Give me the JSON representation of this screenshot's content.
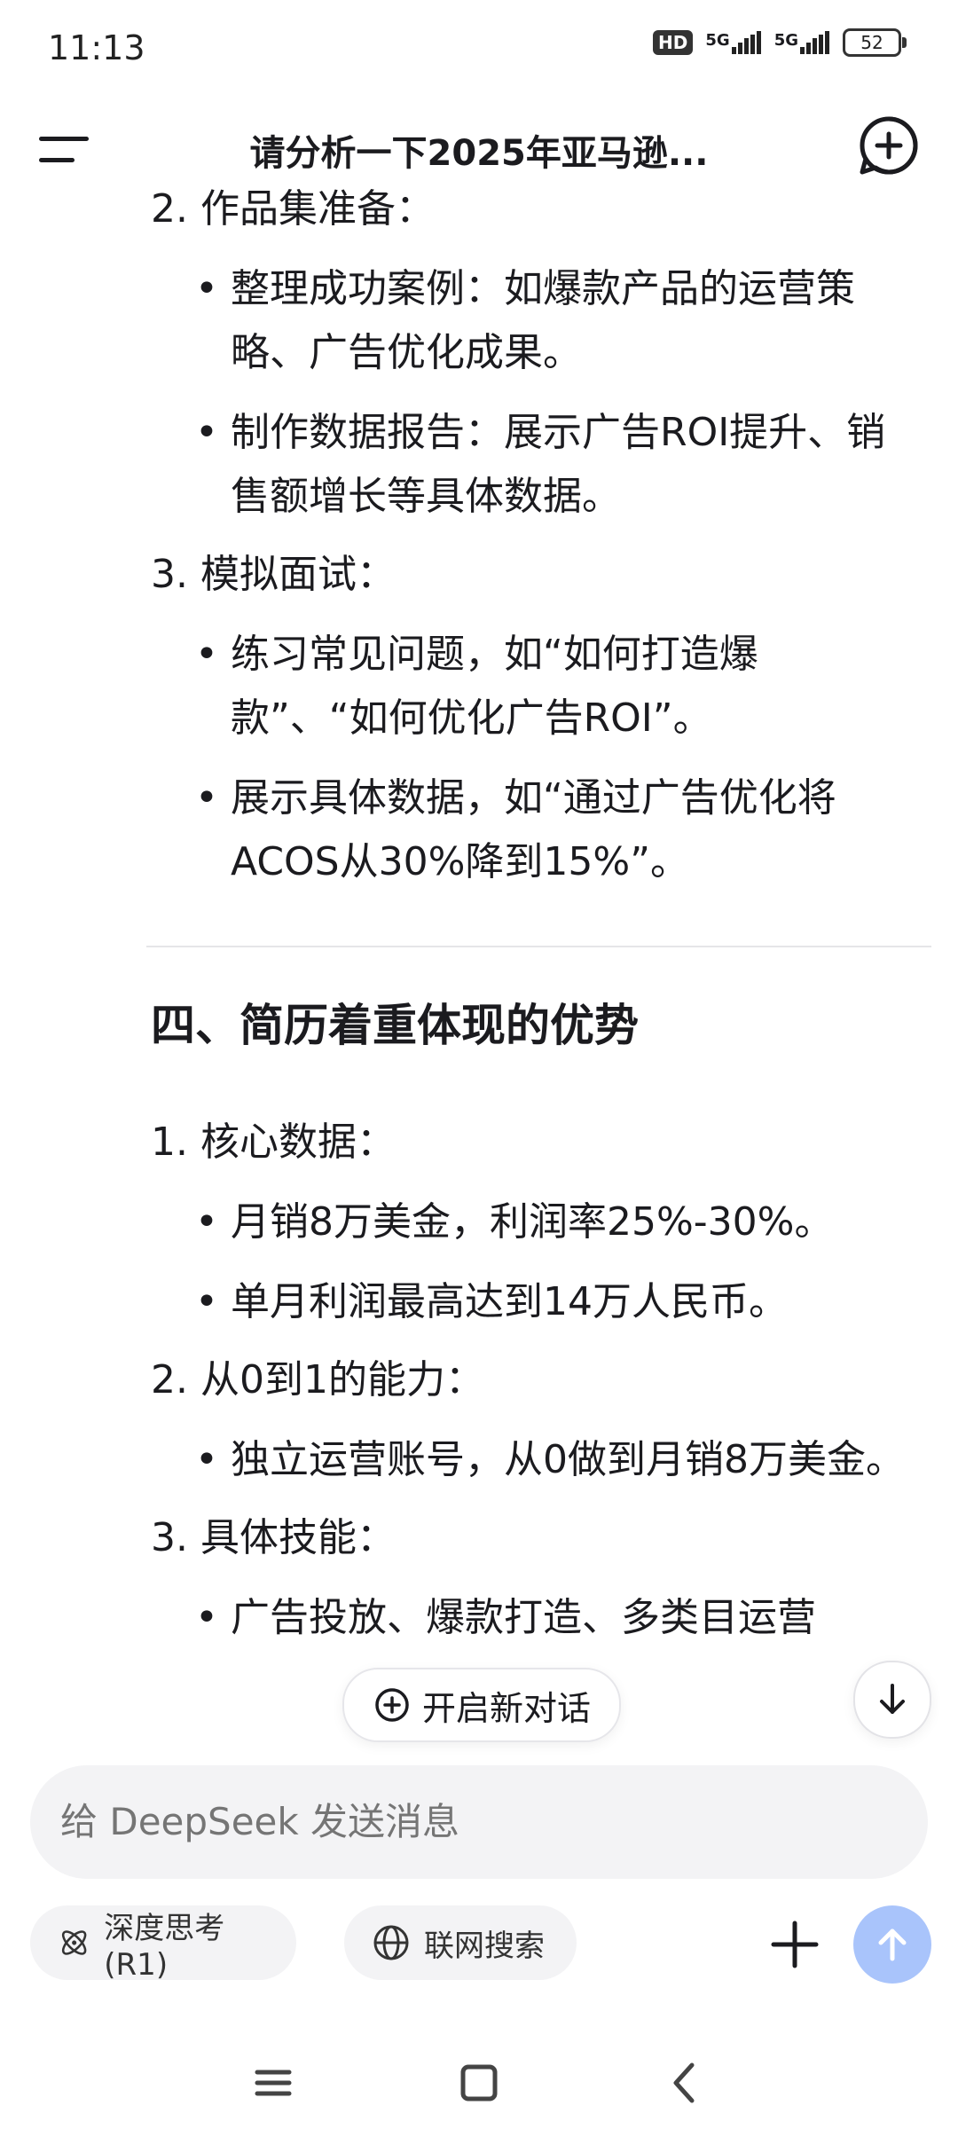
{
  "status_bar": {
    "time": "11:13",
    "network_1": "5G",
    "network_2": "5G",
    "hd": "HD",
    "battery": "52"
  },
  "header": {
    "title": "请分析一下2025年亚马逊..."
  },
  "content": {
    "prep_items": [
      {
        "number_label": "2. 作品集准备：",
        "bullets": [
          "整理成功案例：如爆款产品的运营策略、广告优化成果。",
          "制作数据报告：展示广告ROI提升、销售额增长等具体数据。"
        ]
      },
      {
        "number_label": "3. 模拟面试：",
        "bullets": [
          "练习常见问题，如“如何打造爆款”、“如何优化广告ROI”。",
          "展示具体数据，如“通过广告优化将ACOS从30%降到15%”。"
        ]
      }
    ],
    "section_heading": "四、简历着重体现的优势",
    "advantage_items": [
      {
        "number_label": "1. 核心数据：",
        "bullets": [
          "月销8万美金，利润率25%-30%。",
          "单月利润最高达到14万人民币。"
        ]
      },
      {
        "number_label": "2. 从0到1的能力：",
        "bullets": [
          "独立运营账号，从0做到月销8万美金。"
        ]
      },
      {
        "number_label": "3. 具体技能：",
        "bullets": [
          "广告投放、爆款打造、多类目运营"
        ]
      }
    ]
  },
  "floating": {
    "new_conversation_label": "开启新对话"
  },
  "input": {
    "placeholder": "给 DeepSeek 发送消息"
  },
  "chips": {
    "deep_think": "深度思考 (R1)",
    "web_search": "联网搜索"
  },
  "colors": {
    "send_button": "#a9c4fb",
    "input_bg": "#f3f3f5"
  }
}
